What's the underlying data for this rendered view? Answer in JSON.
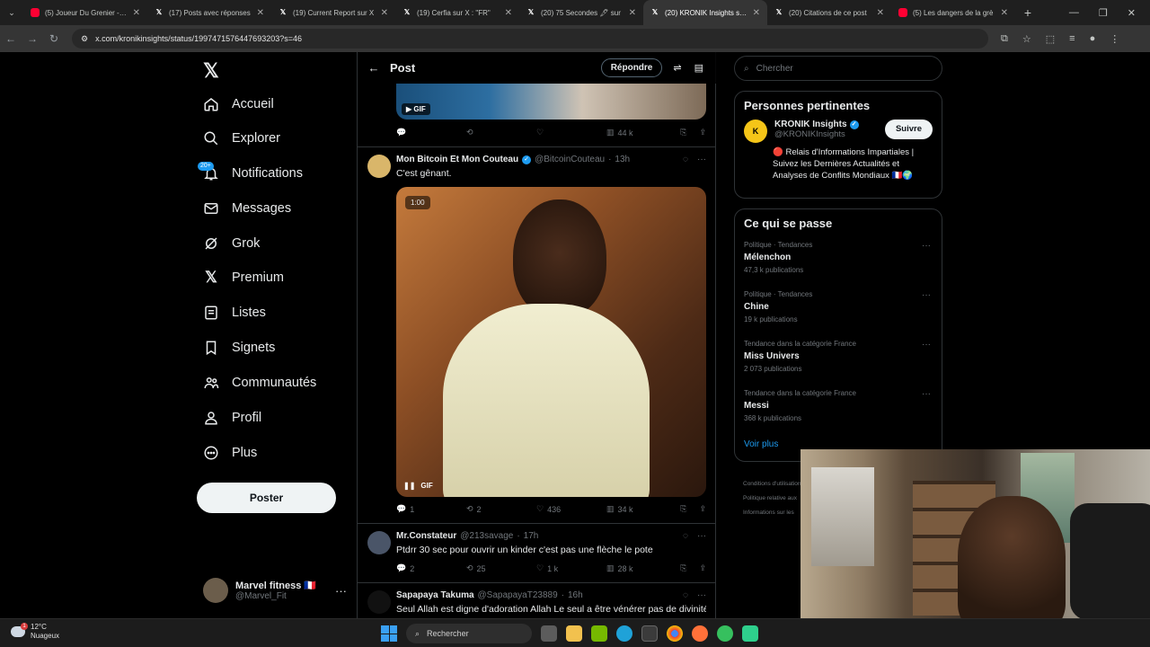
{
  "browser": {
    "tabs": [
      {
        "title": "(5) Joueur Du Grenier - Yo",
        "icon": "youtube-icon",
        "active": false
      },
      {
        "title": "(17) Posts avec réponses",
        "icon": "x-icon",
        "active": false
      },
      {
        "title": "(19) Current Report sur X",
        "icon": "x-icon",
        "active": false
      },
      {
        "title": "(19) Cerfia sur X : \"FR\"",
        "icon": "x-icon",
        "active": false
      },
      {
        "title": "(20) 75 Secondes 🖋 sur",
        "icon": "x-icon",
        "active": false
      },
      {
        "title": "(20) KRONIK Insights sur X",
        "icon": "x-icon",
        "active": true
      },
      {
        "title": "(20) Citations de ce post",
        "icon": "x-icon",
        "active": false
      },
      {
        "title": "(5) Les dangers de la grè",
        "icon": "youtube-icon",
        "active": false
      }
    ],
    "url": "x.com/kronikinsights/status/1997471576447693203?s=46"
  },
  "nav": {
    "items": [
      {
        "label": "Accueil",
        "icon": "home-icon"
      },
      {
        "label": "Explorer",
        "icon": "search-icon"
      },
      {
        "label": "Notifications",
        "icon": "bell-icon",
        "badge": "20+"
      },
      {
        "label": "Messages",
        "icon": "mail-icon"
      },
      {
        "label": "Grok",
        "icon": "grok-icon"
      },
      {
        "label": "Premium",
        "icon": "x-icon"
      },
      {
        "label": "Listes",
        "icon": "list-icon"
      },
      {
        "label": "Signets",
        "icon": "bookmark-icon"
      },
      {
        "label": "Communautés",
        "icon": "people-icon"
      },
      {
        "label": "Profil",
        "icon": "person-icon"
      },
      {
        "label": "Plus",
        "icon": "more-circle-icon"
      }
    ],
    "post_button": "Poster",
    "account": {
      "name": "Marvel fitness 🇫🇷",
      "handle": "@Marvel_Fit"
    }
  },
  "center": {
    "title": "Post",
    "reply_button": "Répondre",
    "top_gif": {
      "label": "GIF",
      "views": "44 k"
    },
    "tweets": [
      {
        "name": "Mon Bitcoin Et Mon Couteau",
        "handle": "@BitcoinCouteau",
        "time": "13h",
        "text": "C'est gênant.",
        "media": {
          "duration": "1:00",
          "label": "GIF"
        },
        "replies": "1",
        "reposts": "2",
        "likes": "436",
        "views": "34 k"
      },
      {
        "name": "Mr.Constateur",
        "handle": "@213savage",
        "time": "17h",
        "text": "Ptdrr 30 sec pour ouvrir un kinder c'est pas une flèche le pote",
        "replies": "2",
        "reposts": "25",
        "likes": "1 k",
        "views": "28 k"
      },
      {
        "name": "Sapapaya Takuma",
        "handle": "@SapapayaT23889",
        "time": "16h",
        "text": "Seul Allah est digne d'adoration Allah Le seul a être vénérer  pas de divinité"
      }
    ]
  },
  "right": {
    "search_placeholder": "Chercher",
    "relevant": {
      "title": "Personnes pertinentes",
      "name": "KRONIK Insights",
      "handle": "@KRONIKInsights",
      "follow": "Suivre",
      "bio": "🔴 Relais d'Informations Impartiales | Suivez les Dernières Actualités et Analyses de Conflits Mondiaux 🇫🇷🌍"
    },
    "trends": {
      "title": "Ce qui se passe",
      "items": [
        {
          "category": "Politique · Tendances",
          "name": "Mélenchon",
          "count": "47,3 k publications"
        },
        {
          "category": "Politique · Tendances",
          "name": "Chine",
          "count": "19 k publications"
        },
        {
          "category": "Tendance dans la catégorie France",
          "name": "Miss Univers",
          "count": "2 073 publications"
        },
        {
          "category": "Tendance dans la catégorie France",
          "name": "Messi",
          "count": "368 k publications"
        }
      ],
      "see_more": "Voir plus"
    },
    "footer": [
      "Conditions d'utilisation",
      "Politique relative aux",
      "Informations sur les"
    ]
  },
  "taskbar": {
    "weather_temp": "12°C",
    "weather_desc": "Nuageux",
    "weather_badge": "1",
    "search_label": "Rechercher"
  },
  "colors": {
    "accent": "#1d9bf0",
    "background": "#000000",
    "border": "#2f3336"
  }
}
